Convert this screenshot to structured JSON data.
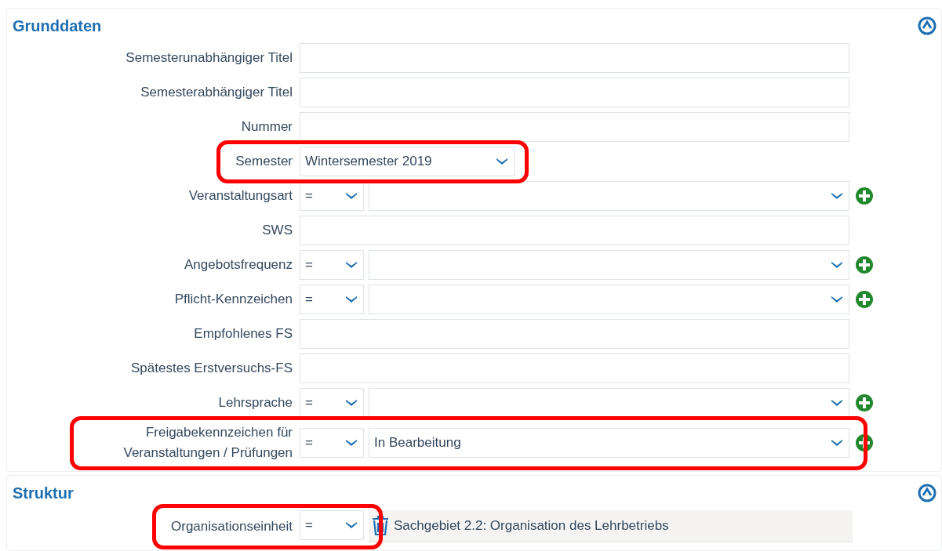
{
  "sections": [
    {
      "title": "Grunddaten",
      "expanded": true,
      "rows": [
        {
          "kind": "text",
          "label": "Semesterunabhängiger Titel",
          "highlighted": false
        },
        {
          "kind": "text",
          "label": "Semesterabhängiger Titel",
          "highlighted": false
        },
        {
          "kind": "text",
          "label": "Nummer",
          "highlighted": false
        },
        {
          "kind": "select",
          "label": "Semester",
          "value": "Wintersemester 2019",
          "highlighted": true
        },
        {
          "kind": "operator_select",
          "label": "Veranstaltungsart",
          "operator": "=",
          "highlighted": false
        },
        {
          "kind": "text",
          "label": "SWS",
          "highlighted": false
        },
        {
          "kind": "operator_select",
          "label": "Angebotsfrequenz",
          "operator": "=",
          "highlighted": false
        },
        {
          "kind": "operator_select",
          "label": "Pflicht-Kennzeichen",
          "operator": "=",
          "highlighted": false
        },
        {
          "kind": "text",
          "label": "Empfohlenes FS",
          "highlighted": false
        },
        {
          "kind": "text",
          "label": "Spätestes Erstversuchs-FS",
          "highlighted": false
        },
        {
          "kind": "operator_select",
          "label": "Lehrsprache",
          "operator": "=",
          "highlighted": false
        },
        {
          "kind": "operator_select",
          "label": "Freigabekennzeichen für Veranstaltungen / Prüfungen",
          "operator": "=",
          "value": "In Bearbeitung",
          "highlighted": true
        }
      ]
    },
    {
      "title": "Struktur",
      "expanded": true,
      "rows": [
        {
          "kind": "org",
          "label": "Organisationseinheit",
          "operator": "=",
          "value": "Sachgebiet 2.2: Organisation des Lehrbetriebs",
          "highlighted": true
        }
      ]
    }
  ]
}
